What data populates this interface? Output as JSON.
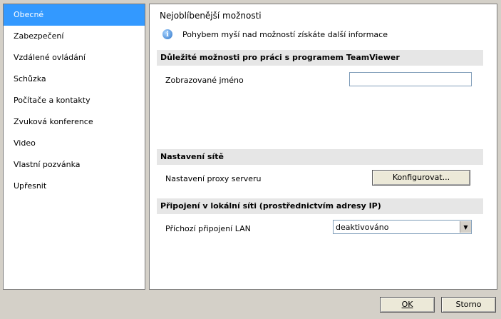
{
  "sidebar": {
    "items": [
      {
        "label": "Obecné",
        "selected": true
      },
      {
        "label": "Zabezpečení"
      },
      {
        "label": "Vzdálené ovládání"
      },
      {
        "label": "Schůzka"
      },
      {
        "label": "Počítače a kontakty"
      },
      {
        "label": "Zvuková konference"
      },
      {
        "label": "Video"
      },
      {
        "label": "Vlastní pozvánka"
      },
      {
        "label": "Upřesnit"
      }
    ]
  },
  "main": {
    "title": "Nejoblíbenější možnosti",
    "hint": "Pohybem myší nad možností získáte další informace",
    "sections": {
      "important": {
        "title": "Důležité možnosti pro práci s programem TeamViewer",
        "display_name_label": "Zobrazované jméno",
        "display_name_value": ""
      },
      "network": {
        "title": "Nastavení sítě",
        "proxy_label": "Nastavení proxy serveru",
        "configure_button": "Konfigurovat..."
      },
      "lan": {
        "title": "Připojení v lokální síti (prostřednictvím adresy IP)",
        "incoming_label": "Příchozí připojení LAN",
        "incoming_value": "deaktivováno"
      }
    }
  },
  "footer": {
    "ok": "OK",
    "cancel": "Storno"
  },
  "colors": {
    "selected": "#3399ff",
    "dialog_bg": "#d4d0c8",
    "section_bg": "#e6e6e6"
  }
}
